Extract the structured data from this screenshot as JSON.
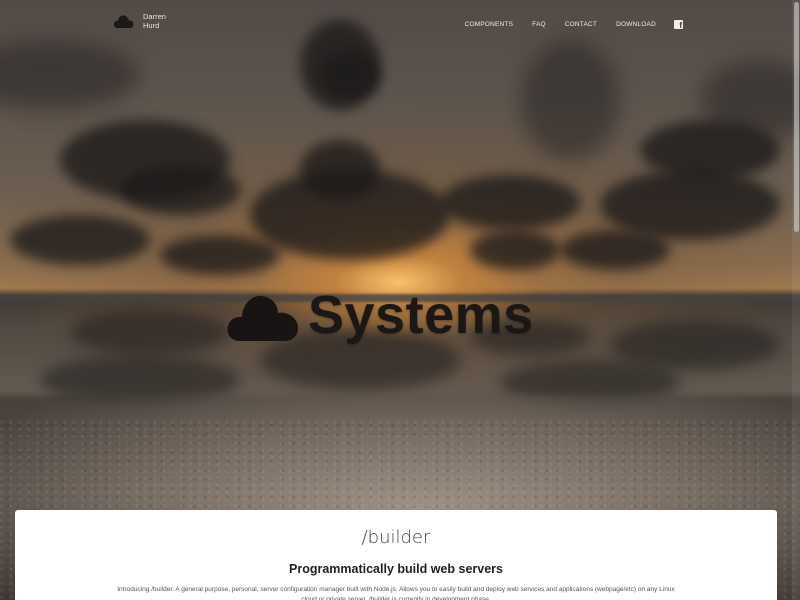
{
  "brand": {
    "name_line1": "Darren",
    "name_line2": "Hurd",
    "logo_icon": "cloud-icon"
  },
  "nav": {
    "items": [
      {
        "label": "COMPONENTS"
      },
      {
        "label": "FAQ"
      },
      {
        "label": "CONTACT"
      },
      {
        "label": "DOWNLOAD"
      }
    ],
    "social_icon": "facebook-icon",
    "social_glyph": "f"
  },
  "hero": {
    "logo_text": "Systems",
    "logo_icon": "cloud-icon"
  },
  "card": {
    "title": "/builder",
    "subtitle": "Programmatically build web servers",
    "body": "Introducing /builder. A general purpose, personal, server configuration manager built with Node.js. Allows you to easily build and deploy web services and applications (webpage/etc) on any Linux cloud or private server. /builder is currently in development phase."
  },
  "colors": {
    "nav_text": "#f0ece8",
    "hero_logo": "#1a1716",
    "card_bg": "#ffffff"
  }
}
